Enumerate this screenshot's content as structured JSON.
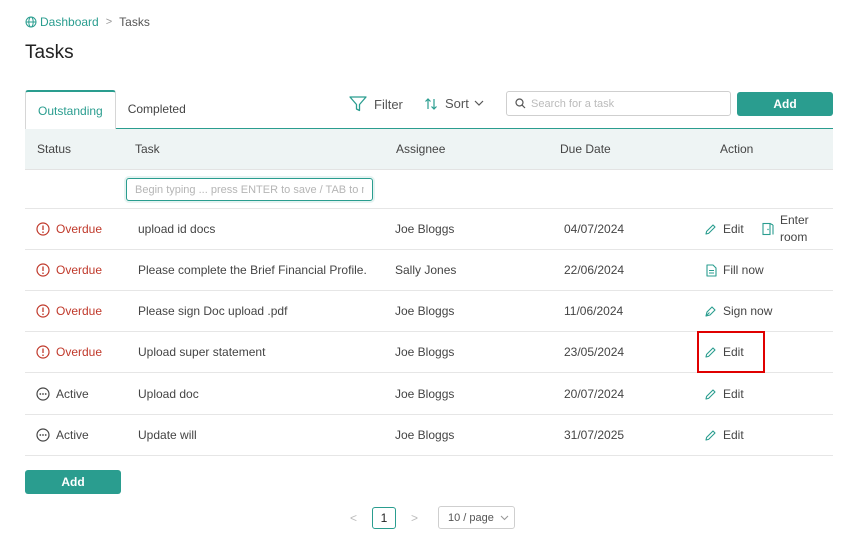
{
  "breadcrumb": {
    "home": "Dashboard",
    "separator": ">",
    "current": "Tasks"
  },
  "page": {
    "title": "Tasks"
  },
  "tabs": [
    {
      "label": "Outstanding",
      "active": true
    },
    {
      "label": "Completed",
      "active": false
    }
  ],
  "toolbar": {
    "filter_label": "Filter",
    "sort_label": "Sort",
    "search_placeholder": "Search for a task",
    "add_label": "Add"
  },
  "table": {
    "headers": [
      "Status",
      "Task",
      "Assignee",
      "Due Date",
      "Action"
    ],
    "entry_placeholder": "Begin typing ... press ENTER to save / TAB to more",
    "rows": [
      {
        "status": "Overdue",
        "task": "upload id docs",
        "assignee": "Joe Bloggs",
        "due": "04/07/2024",
        "action": "Edit",
        "action2": "Enter room"
      },
      {
        "status": "Overdue",
        "task": "Please complete the Brief Financial Profile.",
        "assignee": "Sally Jones",
        "due": "22/06/2024",
        "action": "Fill now"
      },
      {
        "status": "Overdue",
        "task": "Please sign Doc upload .pdf",
        "assignee": "Joe Bloggs",
        "due": "11/06/2024",
        "action": "Sign now"
      },
      {
        "status": "Overdue",
        "task": "Upload super statement",
        "assignee": "Joe Bloggs",
        "due": "23/05/2024",
        "action": "Edit"
      },
      {
        "status": "Active",
        "task": "Upload doc",
        "assignee": "Joe Bloggs",
        "due": "20/07/2024",
        "action": "Edit"
      },
      {
        "status": "Active",
        "task": "Update will",
        "assignee": "Joe Bloggs",
        "due": "31/07/2025",
        "action": "Edit"
      }
    ]
  },
  "footer": {
    "add_label": "Add"
  },
  "pagination": {
    "current_page": "1",
    "page_size": "10 / page",
    "prev": "<",
    "next": ">"
  },
  "colors": {
    "accent": "#2a9d8f",
    "overdue": "#c0392b",
    "highlight": "#e00000"
  },
  "icons": {
    "breadcrumb_home": "globe-icon",
    "filter": "filter-icon",
    "sort": "sort-icon",
    "search": "search-icon",
    "overdue": "alert-circle-icon",
    "active": "ellipsis-circle-icon",
    "edit": "pencil-icon",
    "enter_room": "door-icon",
    "fill": "document-icon",
    "sign": "pen-nib-icon"
  }
}
